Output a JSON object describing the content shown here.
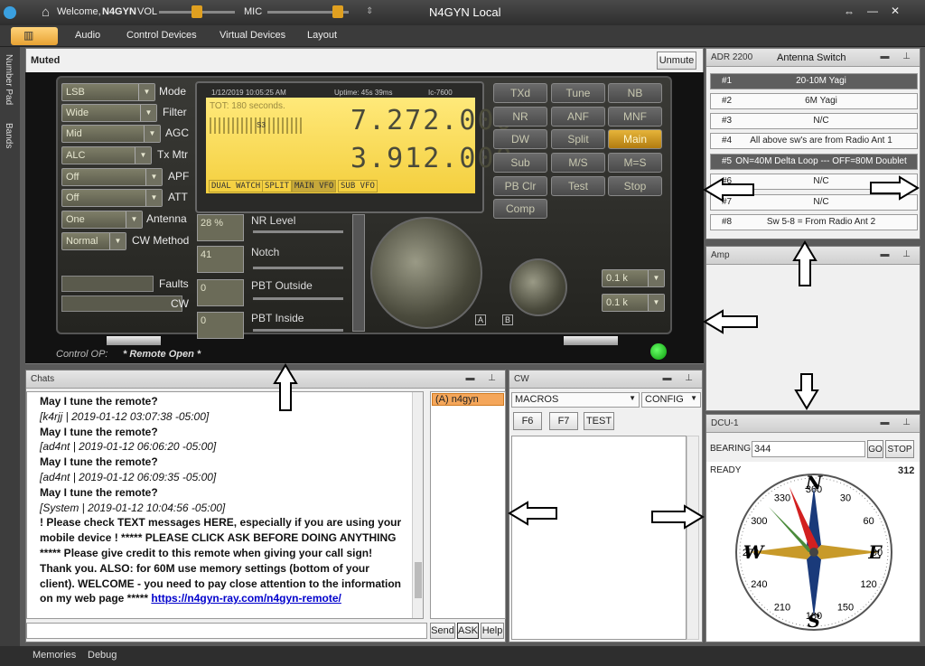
{
  "titlebar": {
    "welcome": "Welcome,",
    "callsign": "N4GYN",
    "vol": "VOL",
    "mic": "MIC",
    "title": "N4GYN Local",
    "controls": [
      "⇔",
      "—",
      "✕"
    ]
  },
  "menu": [
    "Audio",
    "Control Devices",
    "Virtual Devices",
    "Layout"
  ],
  "side_tabs": [
    "Number Pad",
    "Bands"
  ],
  "radio_panel": {
    "status": "Muted",
    "unmute": "Unmute",
    "control_op": "Control OP:",
    "remote_open": "* Remote Open *",
    "left_controls": [
      {
        "value": "LSB",
        "label": "Mode"
      },
      {
        "value": "Wide",
        "label": "Filter"
      },
      {
        "value": "Mid",
        "label": "AGC"
      },
      {
        "value": "ALC",
        "label": "Tx Mtr"
      },
      {
        "value": "Off",
        "label": "APF"
      },
      {
        "value": "Off",
        "label": "ATT"
      },
      {
        "value": "One",
        "label": "Antenna"
      },
      {
        "value": "Normal",
        "label": "CW Method"
      }
    ],
    "faults": "Faults",
    "cw": "CW",
    "display": {
      "datetime": "1/12/2019 10:05:25 AM",
      "uptime": "Uptime: 45s 39ms",
      "model": "Ic-7600",
      "tot": "TOT: 180 seconds.",
      "smeter": "S3",
      "vfo_main": "7.272.000",
      "vfo_sub": "3.912.000",
      "buttons": [
        "DUAL WATCH",
        "SPLIT",
        "MAIN VFO",
        "SUB VFO"
      ]
    },
    "sliders": [
      {
        "value": "28 %",
        "label": "NR Level"
      },
      {
        "value": "41",
        "label": "Notch"
      },
      {
        "value": "0",
        "label": "PBT Outside"
      },
      {
        "value": "0",
        "label": "PBT Inside"
      }
    ],
    "knob_labels": [
      "A",
      "B"
    ],
    "filter_combos": [
      "0.1 k",
      "0.1 k"
    ],
    "buttons": [
      [
        "TXd",
        "Tune",
        "NB"
      ],
      [
        "NR",
        "ANF",
        "MNF"
      ],
      [
        "DW",
        "Split",
        "Main"
      ],
      [
        "Sub",
        "M/S",
        "M=S"
      ],
      [
        "PB Clr",
        "Test",
        "Stop"
      ],
      [
        "Comp"
      ]
    ],
    "active_button": "Main"
  },
  "chats": {
    "title": "Chats",
    "messages": [
      {
        "text": "May I tune the remote?",
        "style": "bold"
      },
      {
        "text": "[k4rjj | 2019-01-12 03:07:38 -05:00]",
        "style": "ital"
      },
      {
        "text": "May I tune the remote?",
        "style": "bold"
      },
      {
        "text": "[ad4nt | 2019-01-12 06:06:20 -05:00]",
        "style": "ital"
      },
      {
        "text": "May I tune the remote?",
        "style": "bold"
      },
      {
        "text": "[ad4nt | 2019-01-12 06:09:35 -05:00]",
        "style": "ital"
      },
      {
        "text": "May I tune the remote?",
        "style": "bold"
      },
      {
        "text": "[System | 2019-01-12 10:04:56 -05:00]",
        "style": "ital"
      },
      {
        "text": "! Please check TEXT messages HERE, especially if you are using your",
        "style": "bold"
      },
      {
        "text": "mobile device ! ***** PLEASE CLICK ASK BEFORE DOING ANYTHING",
        "style": "bold"
      },
      {
        "text": "***** Please give credit to this remote when giving your call sign!",
        "style": "bold"
      },
      {
        "text": "Thank you. ALSO: for 60M use memory settings (bottom of your",
        "style": "bold"
      },
      {
        "text": "client). WELCOME - you need to pay close attention to the information",
        "style": "bold"
      }
    ],
    "last_line_prefix": "on my web page ***** ",
    "link": "https://n4gyn-ray.com/n4gyn-remote/",
    "user": "(A) n4gyn",
    "send": "Send",
    "ask": "ASK",
    "help": "Help"
  },
  "cw": {
    "title": "CW",
    "macros": "MACROS",
    "config": "CONFIG",
    "buttons": [
      "F6",
      "F7",
      "TEST"
    ]
  },
  "antenna_switch": {
    "device": "ADR 2200",
    "title": "Antenna Switch",
    "rows": [
      {
        "num": "#1",
        "name": "20-10M Yagi"
      },
      {
        "num": "#2",
        "name": "6M Yagi"
      },
      {
        "num": "#3",
        "name": "N/C"
      },
      {
        "num": "#4",
        "name": "All above sw's are from Radio Ant 1"
      },
      {
        "num": "#5",
        "name": "ON=40M Delta Loop --- OFF=80M Doublet"
      },
      {
        "num": "#6",
        "name": "N/C"
      },
      {
        "num": "#7",
        "name": "N/C"
      },
      {
        "num": "#8",
        "name": "Sw 5-8 = From Radio Ant 2"
      }
    ],
    "selected": [
      0,
      4
    ]
  },
  "amp": {
    "title": "Amp"
  },
  "dcu": {
    "title": "DCU-1",
    "bearing_label": "BEARING",
    "bearing": "344",
    "go": "GO",
    "stop": "STOP",
    "status": "READY",
    "heading": "312",
    "dial": [
      "360",
      "30",
      "60",
      "90",
      "120",
      "150",
      "180",
      "210",
      "240",
      "270",
      "300",
      "330"
    ],
    "cardinals": [
      "N",
      "E",
      "S",
      "W"
    ]
  },
  "statusbar": [
    "Memories",
    "Debug"
  ],
  "colors": {
    "lcd": "#f4cf3e",
    "active_btn": "#e6b43a",
    "link": "#0000cc"
  }
}
